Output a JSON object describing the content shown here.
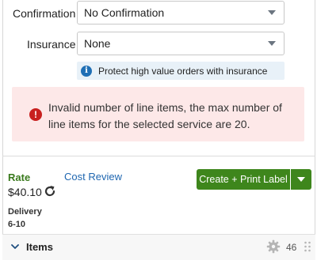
{
  "confirmation": {
    "label": "Confirmation",
    "value": "No Confirmation"
  },
  "insurance": {
    "label": "Insurance",
    "value": "None"
  },
  "insurance_info": {
    "text": "Protect high value orders with insurance",
    "icon": "info-icon"
  },
  "error": {
    "icon": "alert-icon",
    "message": "Invalid number of line items, the max number of line items for the selected service are 20."
  },
  "rate": {
    "label": "Rate",
    "cost_review": "Cost Review",
    "value": "$40.10"
  },
  "actions": {
    "create_label": "Create + Print Label"
  },
  "delivery": {
    "label": "Delivery",
    "value": "6-10"
  },
  "items": {
    "title": "Items",
    "count": "46"
  },
  "colors": {
    "accent_green": "#3e861c",
    "link_blue": "#1e66b0",
    "error_bg": "#fde8e8",
    "info_bg": "#e8f1f8"
  }
}
